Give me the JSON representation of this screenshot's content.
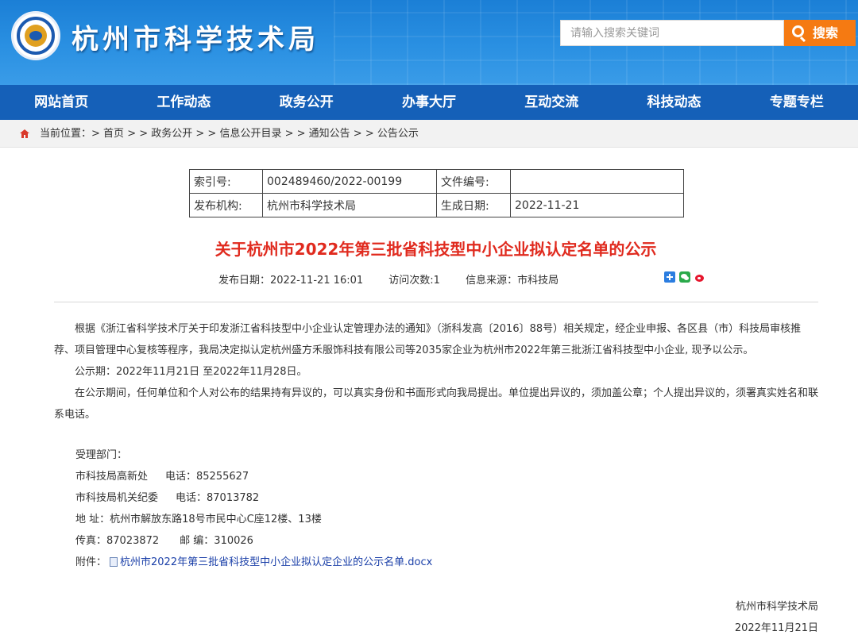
{
  "header": {
    "site_title": "杭州市科学技术局",
    "search_placeholder": "请输入搜索关键词",
    "search_button": "搜索",
    "logo_icon": "bureau-emblem-icon"
  },
  "nav": {
    "items": [
      "网站首页",
      "工作动态",
      "政务公开",
      "办事大厅",
      "互动交流",
      "科技动态",
      "专题专栏"
    ]
  },
  "breadcrumb": {
    "prefix": "当前位置：",
    "items": [
      "首页",
      "政务公开",
      "信息公开目录",
      "通知公告",
      "公告公示"
    ],
    "separator": "> >",
    "home_icon": "home-icon"
  },
  "meta": {
    "index_label": "索引号:",
    "index_value": "002489460/2022-00199",
    "docno_label": "文件编号:",
    "docno_value": "",
    "publisher_label": "发布机构:",
    "publisher_value": "杭州市科学技术局",
    "date_label": "生成日期:",
    "date_value": "2022-11-21"
  },
  "article": {
    "title": "关于杭州市2022年第三批省科技型中小企业拟认定名单的公示",
    "publish_date": "发布日期：2022-11-21 16:01",
    "visits": "访问次数:1",
    "source": "信息来源：市科技局",
    "share_icons": [
      "share-plus-icon",
      "wechat-icon",
      "weibo-icon"
    ],
    "p1": "根据《浙江省科学技术厅关于印发浙江省科技型中小企业认定管理办法的通知》（浙科发高〔2016〕88号）相关规定，经企业申报、各区县（市）科技局审核推荐、项目管理中心复核等程序，我局决定拟认定杭州盛方禾服饰科技有限公司等2035家企业为杭州市2022年第三批浙江省科技型中小企业, 现予以公示。",
    "p2": "公示期：2022年11月21日 至2022年11月28日。",
    "p3": "在公示期间，任何单位和个人对公布的结果持有异议的，可以真实身份和书面形式向我局提出。单位提出异议的，须加盖公章；个人提出异议的，须署真实姓名和联系电话。"
  },
  "contacts": {
    "dept_label": "受理部门：",
    "dept1": "市科技局高新处",
    "phone1": "电话：85255627",
    "dept2": "市科技局机关纪委",
    "phone2": "电话：87013782",
    "address": "地 址：杭州市解放东路18号市民中心C座12楼、13楼",
    "fax": "传真：87023872",
    "postcode": "邮 编：310026",
    "attach_label": "附件：",
    "attach_name": "杭州市2022年第三批省科技型中小企业拟认定企业的公示名单.docx",
    "attach_icon": "doc-file-icon"
  },
  "signature": {
    "org": "杭州市科学技术局",
    "date": "2022年11月21日"
  }
}
